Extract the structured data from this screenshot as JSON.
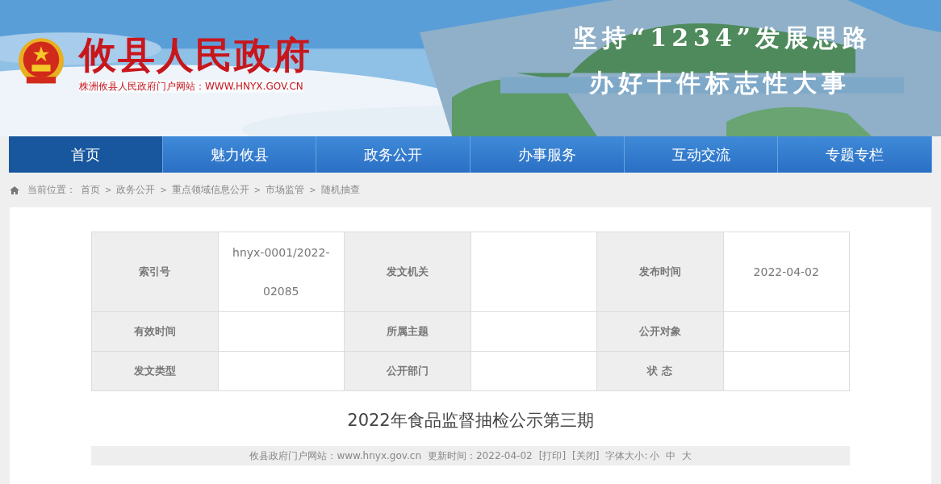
{
  "header": {
    "title": "攸县人民政府",
    "subtitle": "株洲攸县人民政府门户网站：WWW.HNYX.GOV.CN",
    "slogan": [
      "坚持“1234”发展思路",
      "办好十件标志性大事"
    ]
  },
  "nav": [
    {
      "label": "首页",
      "selected": true
    },
    {
      "label": "魅力攸县",
      "selected": false
    },
    {
      "label": "政务公开",
      "selected": false
    },
    {
      "label": "办事服务",
      "selected": false
    },
    {
      "label": "互动交流",
      "selected": false
    },
    {
      "label": "专题专栏",
      "selected": false
    }
  ],
  "breadcrumb": {
    "label": "当前位置：",
    "separator": ">",
    "items": [
      "首页",
      "政务公开",
      "重点领域信息公开",
      "市场监管",
      "随机抽查"
    ]
  },
  "info_table": [
    [
      {
        "label": "索引号",
        "value": "hnyx-0001/2022-02085"
      },
      {
        "label": "发文机关"
      },
      {
        "label": "发布时间",
        "value": "2022-04-02"
      }
    ],
    [
      {
        "label": "有效时间"
      },
      {
        "label": "所属主题"
      },
      {
        "label": "公开对象"
      }
    ],
    [
      {
        "label": "发文类型"
      },
      {
        "label": "公开部门"
      },
      {
        "label": "状 态"
      }
    ]
  ],
  "article": {
    "title": "2022年食品监督抽检公示第三期",
    "meta": [
      {
        "kind": "text",
        "text": "攸县政府门户网站：www.hnyx.gov.cn"
      },
      {
        "kind": "text",
        "text": "更新时间：2022-04-02"
      },
      {
        "kind": "link",
        "text": "[打印]"
      },
      {
        "kind": "link",
        "text": "[关闭]"
      },
      {
        "kind": "fontsize",
        "text": "字体大小:",
        "sizes": [
          "小",
          "中",
          "大"
        ]
      }
    ]
  }
}
